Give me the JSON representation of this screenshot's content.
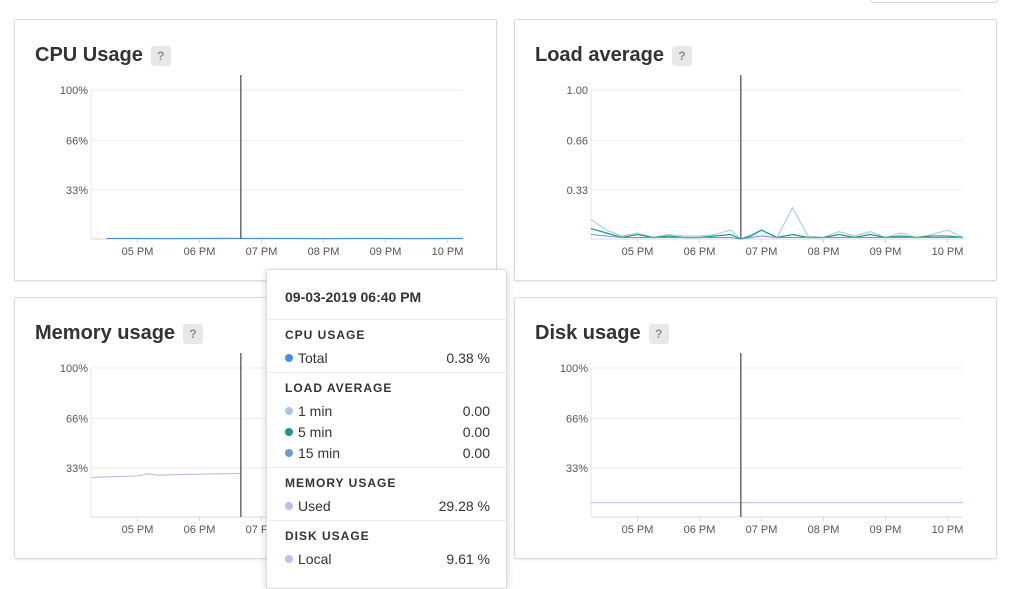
{
  "colors": {
    "cpu_total": "#4a90d9",
    "load_1min": "#a8c8e8",
    "load_5min": "#1a9a8a",
    "load_15min": "#6a9ad4",
    "memory_used": "#c4b8ec",
    "disk_local": "#b8c4ec",
    "cursor": "#555555",
    "grid": "#eeeeee"
  },
  "panels": {
    "cpu": {
      "title": "CPU Usage",
      "help": "?"
    },
    "load": {
      "title": "Load average",
      "help": "?"
    },
    "memory": {
      "title": "Memory usage",
      "help": "?"
    },
    "disk": {
      "title": "Disk usage",
      "help": "?"
    }
  },
  "chart_data": [
    {
      "type": "line",
      "title": "CPU Usage",
      "x": [
        "04:30 PM",
        "05:00 PM",
        "05:30 PM",
        "06:00 PM",
        "06:30 PM",
        "06:40 PM",
        "07:00 PM",
        "07:30 PM",
        "08:00 PM",
        "08:30 PM",
        "09:00 PM",
        "09:30 PM",
        "10:00 PM",
        "10:15 PM"
      ],
      "x_ticks": [
        "05 PM",
        "06 PM",
        "07 PM",
        "08 PM",
        "09 PM",
        "10 PM"
      ],
      "y_ticks": [
        "33%",
        "66%",
        "100%"
      ],
      "ylim": [
        0,
        100
      ],
      "series": [
        {
          "name": "Total",
          "values": [
            0.4,
            0.4,
            0.3,
            0.4,
            0.5,
            0.38,
            0.4,
            0.4,
            0.3,
            0.4,
            0.4,
            0.3,
            0.4,
            0.4
          ]
        }
      ],
      "grid": true
    },
    {
      "type": "line",
      "title": "Load average",
      "x": [
        "04:15 PM",
        "04:30 PM",
        "04:45 PM",
        "05:00 PM",
        "05:15 PM",
        "05:30 PM",
        "05:45 PM",
        "06:00 PM",
        "06:15 PM",
        "06:30 PM",
        "06:40 PM",
        "06:50 PM",
        "07:00 PM",
        "07:15 PM",
        "07:30 PM",
        "07:45 PM",
        "08:00 PM",
        "08:15 PM",
        "08:30 PM",
        "08:45 PM",
        "09:00 PM",
        "09:15 PM",
        "09:30 PM",
        "09:45 PM",
        "10:00 PM",
        "10:15 PM"
      ],
      "x_ticks": [
        "05 PM",
        "06 PM",
        "07 PM",
        "08 PM",
        "09 PM",
        "10 PM"
      ],
      "y_ticks": [
        "0.33",
        "0.66",
        "1.00"
      ],
      "ylim": [
        0,
        1
      ],
      "series": [
        {
          "name": "1 min",
          "values": [
            0.13,
            0.06,
            0.02,
            0.04,
            0.01,
            0.03,
            0.02,
            0.02,
            0.03,
            0.06,
            0.0,
            0.03,
            0.06,
            0.01,
            0.21,
            0.02,
            0.01,
            0.05,
            0.02,
            0.05,
            0.01,
            0.04,
            0.01,
            0.03,
            0.06,
            0.01
          ]
        },
        {
          "name": "5 min",
          "values": [
            0.07,
            0.04,
            0.01,
            0.03,
            0.01,
            0.02,
            0.01,
            0.01,
            0.02,
            0.03,
            0.0,
            0.02,
            0.06,
            0.01,
            0.03,
            0.01,
            0.01,
            0.03,
            0.01,
            0.03,
            0.01,
            0.02,
            0.01,
            0.02,
            0.02,
            0.01
          ]
        },
        {
          "name": "15 min",
          "values": [
            0.03,
            0.02,
            0.01,
            0.01,
            0.01,
            0.01,
            0.01,
            0.01,
            0.01,
            0.01,
            0.0,
            0.01,
            0.02,
            0.01,
            0.01,
            0.01,
            0.01,
            0.01,
            0.01,
            0.01,
            0.01,
            0.01,
            0.01,
            0.01,
            0.01,
            0.01
          ]
        }
      ],
      "grid": true
    },
    {
      "type": "line",
      "title": "Memory usage",
      "x": [
        "04:15 PM",
        "04:30 PM",
        "05:00 PM",
        "05:10 PM",
        "05:20 PM",
        "05:30 PM",
        "06:00 PM",
        "06:30 PM",
        "06:40 PM"
      ],
      "x_ticks": [
        "05 PM",
        "06 PM",
        "07 PM"
      ],
      "y_ticks": [
        "33%",
        "66%",
        "100%"
      ],
      "ylim": [
        0,
        100
      ],
      "series": [
        {
          "name": "Used",
          "values": [
            26.5,
            27.0,
            27.5,
            29.0,
            28.0,
            28.3,
            28.7,
            29.1,
            29.28
          ]
        }
      ],
      "grid": true
    },
    {
      "type": "line",
      "title": "Disk usage",
      "x": [
        "04:15 PM",
        "05:00 PM",
        "06:00 PM",
        "07:00 PM",
        "08:00 PM",
        "09:00 PM",
        "10:00 PM",
        "10:15 PM"
      ],
      "x_ticks": [
        "05 PM",
        "06 PM",
        "07 PM",
        "08 PM",
        "09 PM",
        "10 PM"
      ],
      "y_ticks": [
        "33%",
        "66%",
        "100%"
      ],
      "ylim": [
        0,
        100
      ],
      "series": [
        {
          "name": "Local",
          "values": [
            9.61,
            9.61,
            9.61,
            9.61,
            9.61,
            9.61,
            9.61,
            9.61
          ]
        }
      ],
      "grid": true
    }
  ],
  "tooltip": {
    "timestamp": "09-03-2019 06:40 PM",
    "sections": [
      {
        "title": "CPU USAGE",
        "rows": [
          {
            "name": "Total",
            "value": "0.38 %"
          }
        ]
      },
      {
        "title": "LOAD AVERAGE",
        "rows": [
          {
            "name": "1 min",
            "value": "0.00"
          },
          {
            "name": "5 min",
            "value": "0.00"
          },
          {
            "name": "15 min",
            "value": "0.00"
          }
        ]
      },
      {
        "title": "MEMORY USAGE",
        "rows": [
          {
            "name": "Used",
            "value": "29.28 %"
          }
        ]
      },
      {
        "title": "DISK USAGE",
        "rows": [
          {
            "name": "Local",
            "value": "9.61 %"
          }
        ]
      }
    ]
  }
}
